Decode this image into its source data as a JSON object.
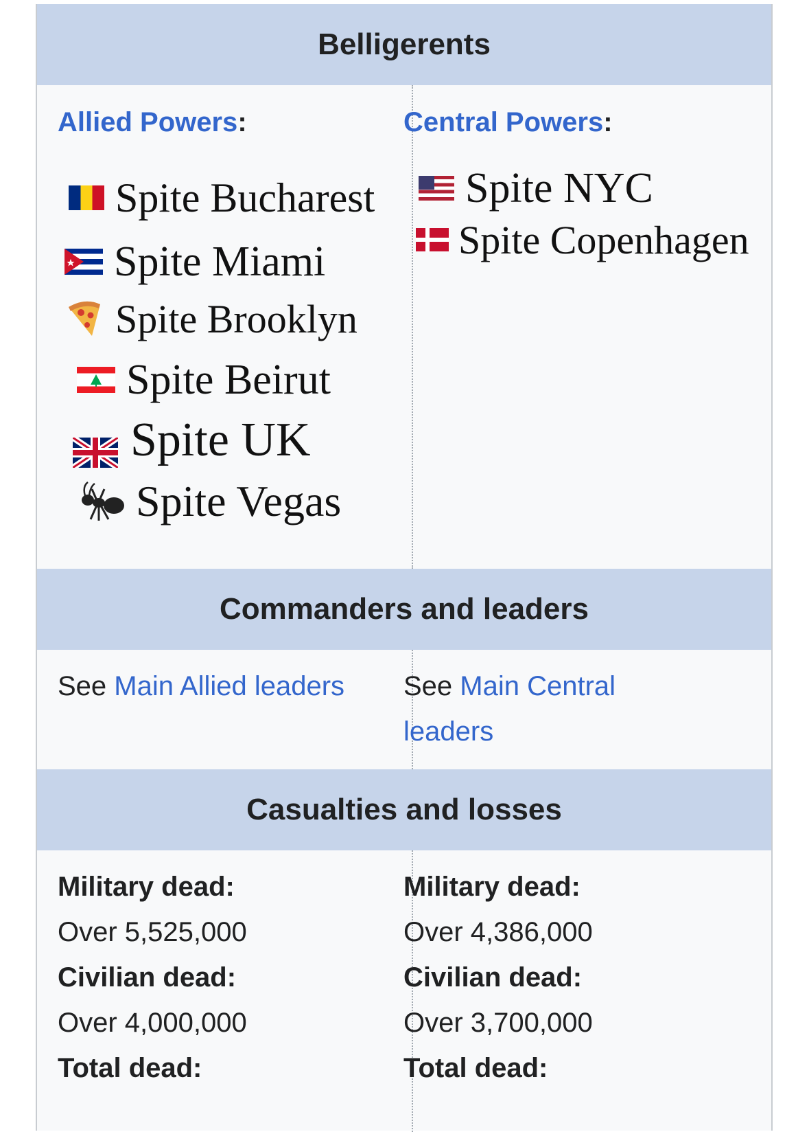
{
  "belligerents": {
    "heading": "Belligerents",
    "allied": {
      "label": "Allied Powers",
      "colon": ":",
      "members": [
        {
          "name": "Spite Bucharest",
          "icon": "romania-flag-icon"
        },
        {
          "name": "Spite Miami",
          "icon": "cuba-flag-icon"
        },
        {
          "name": "Spite Brooklyn",
          "icon": "pizza-icon"
        },
        {
          "name": "Spite Beirut",
          "icon": "lebanon-flag-icon"
        },
        {
          "name": "Spite UK",
          "icon": "uk-flag-icon"
        },
        {
          "name": "Spite Vegas",
          "icon": "ant-icon"
        }
      ]
    },
    "central": {
      "label": "Central Powers",
      "colon": ":",
      "members": [
        {
          "name": "Spite NYC",
          "icon": "usa-flag-icon"
        },
        {
          "name": "Spite Copenhagen",
          "icon": "denmark-flag-icon"
        }
      ]
    }
  },
  "commanders": {
    "heading": "Commanders and leaders",
    "allied": {
      "prefix": "See ",
      "link": "Main Allied leaders"
    },
    "central": {
      "prefix": "See ",
      "link_line1": "Main Central",
      "link_line2": "leaders"
    }
  },
  "casualties": {
    "heading": "Casualties and losses",
    "allied": {
      "military_label": "Military dead:",
      "military_value": "Over 5,525,000",
      "civilian_label": "Civilian dead:",
      "civilian_value": "Over 4,000,000",
      "total_label": "Total dead:"
    },
    "central": {
      "military_label": "Military dead:",
      "military_value": "Over 4,386,000",
      "civilian_label": "Civilian dead:",
      "civilian_value": "Over 3,700,000",
      "total_label": "Total dead:"
    }
  },
  "colors": {
    "header_bg": "#c6d4ea",
    "link": "#3366cc",
    "cell_bg": "#f8f9fa"
  }
}
